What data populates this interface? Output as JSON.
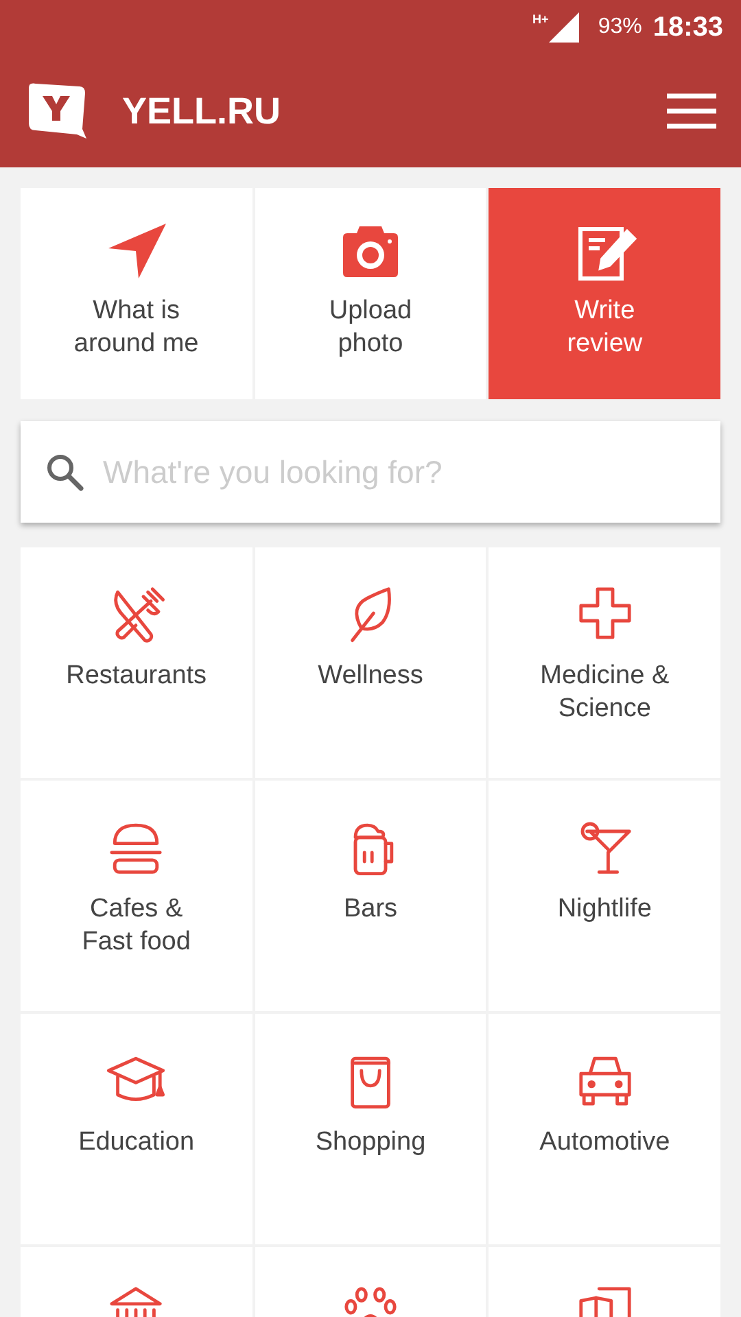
{
  "status_bar": {
    "network": "H+",
    "battery": "93%",
    "time": "18:33"
  },
  "app_bar": {
    "title": "YELL.RU"
  },
  "actions": [
    {
      "label": "What is\naround me",
      "selected": false
    },
    {
      "label": "Upload\nphoto",
      "selected": false
    },
    {
      "label": "Write\nreview",
      "selected": true
    }
  ],
  "search": {
    "placeholder": "What're you looking for?"
  },
  "categories": [
    {
      "label": "Restaurants"
    },
    {
      "label": "Wellness"
    },
    {
      "label": "Medicine &\nScience"
    },
    {
      "label": "Cafes &\nFast food"
    },
    {
      "label": "Bars"
    },
    {
      "label": "Nightlife"
    },
    {
      "label": "Education"
    },
    {
      "label": "Shopping"
    },
    {
      "label": "Automotive"
    }
  ]
}
